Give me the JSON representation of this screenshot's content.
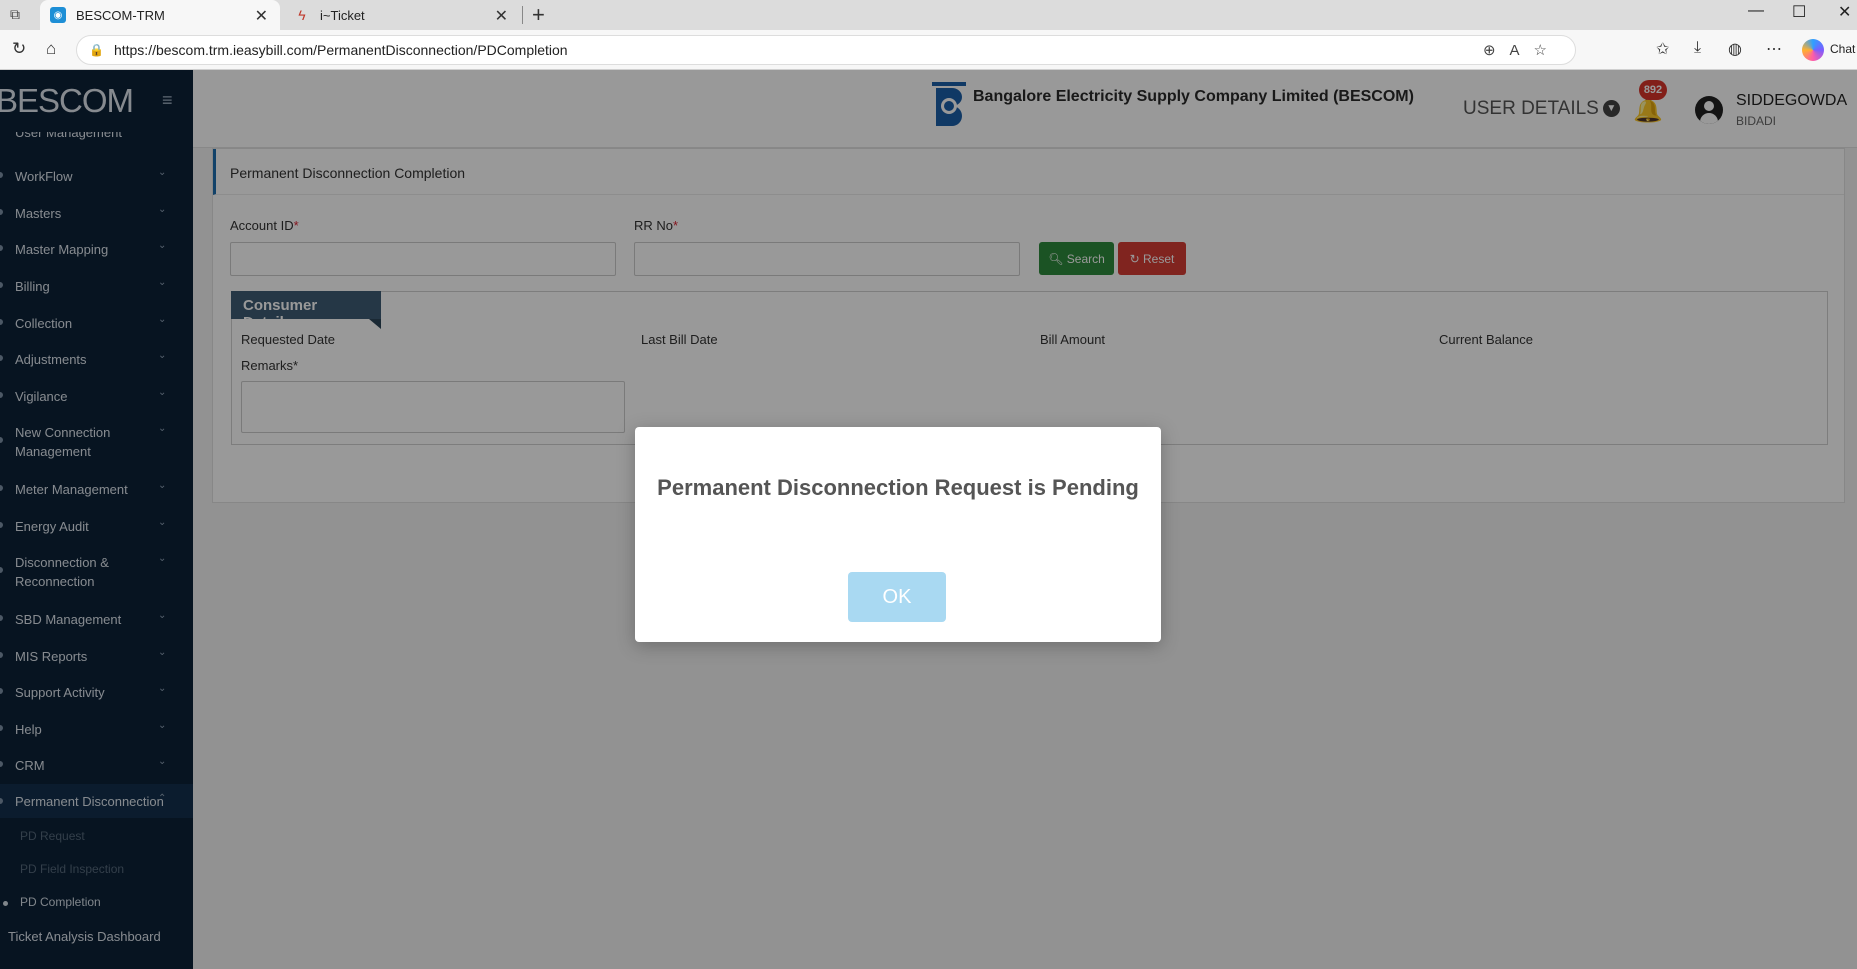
{
  "browser": {
    "tabs": [
      {
        "title": "BESCOM-TRM"
      },
      {
        "title": "i~Ticket"
      }
    ],
    "url": "https://bescom.trm.ieasybill.com/PermanentDisconnection/PDCompletion",
    "chat_label": "Chat"
  },
  "sidebar": {
    "brand": "BESCOM",
    "items": [
      {
        "label": "User Management"
      },
      {
        "label": "WorkFlow"
      },
      {
        "label": "Masters"
      },
      {
        "label": "Master Mapping"
      },
      {
        "label": "Billing"
      },
      {
        "label": "Collection"
      },
      {
        "label": "Adjustments"
      },
      {
        "label": "Vigilance"
      },
      {
        "label": "New Connection Management"
      },
      {
        "label": "Meter Management"
      },
      {
        "label": "Energy Audit"
      },
      {
        "label": "Disconnection & Reconnection"
      },
      {
        "label": "SBD Management"
      },
      {
        "label": "MIS Reports"
      },
      {
        "label": "Support Activity"
      },
      {
        "label": "Help"
      },
      {
        "label": "CRM"
      },
      {
        "label": "Permanent Disconnection"
      }
    ],
    "sub_items": [
      {
        "label": "PD Request"
      },
      {
        "label": "PD Field Inspection"
      },
      {
        "label": "PD Completion"
      }
    ],
    "after_items": [
      {
        "label": "Ticket Analysis Dashboard"
      }
    ]
  },
  "header": {
    "company": "Bangalore Electricity Supply Company Limited (BESCOM)",
    "user_details_label": "USER DETAILS",
    "notification_count": "892",
    "user_name": "SIDDEGOWDA",
    "user_location": "BIDADI"
  },
  "page": {
    "title": "Permanent Disconnection Completion",
    "account_id_label": "Account ID",
    "rr_no_label": "RR No",
    "required_mark": "*",
    "search_label": "Search",
    "reset_label": "Reset",
    "consumer_details_label": "Consumer Details",
    "requested_date_label": "Requested Date",
    "last_bill_date_label": "Last Bill Date",
    "bill_amount_label": "Bill Amount",
    "current_balance_label": "Current Balance",
    "remarks_label": "Remarks"
  },
  "modal": {
    "message": "Permanent Disconnection Request is Pending",
    "ok_label": "OK"
  }
}
